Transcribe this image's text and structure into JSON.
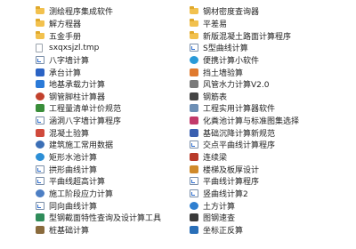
{
  "colors": {
    "folder": "#f2c14e",
    "background": "#ffffff",
    "text": "#222222"
  },
  "left_items": [
    {
      "label": "测绘程序集成软件",
      "icon": "folder-icon",
      "kind": "folder",
      "color": "#f2c14e"
    },
    {
      "label": "解方程器",
      "icon": "folder-icon",
      "kind": "folder",
      "color": "#f2c14e"
    },
    {
      "label": "五金手册",
      "icon": "folder-icon",
      "kind": "folder",
      "color": "#f2c14e"
    },
    {
      "label": "sxqxsjzl.tmp",
      "icon": "tmp-file-icon",
      "kind": "file",
      "color": "#ffffff"
    },
    {
      "label": "八字墙计算",
      "icon": "shortcut-icon",
      "kind": "shortcut",
      "color": "#ffffff"
    },
    {
      "label": "承台计算",
      "icon": "cap-calculation-app-icon",
      "kind": "app",
      "color": "#2b63c4"
    },
    {
      "label": "地基承载力计算",
      "icon": "foundation-bearing-app-icon",
      "kind": "app",
      "color": "#2a7ad8"
    },
    {
      "label": "钢管脚柱计算器",
      "icon": "steel-pipe-app-icon",
      "kind": "round",
      "color": "#c2412d"
    },
    {
      "label": "工程量清单计价规范",
      "icon": "pricing-code-app-icon",
      "kind": "app",
      "color": "#3a8e3a"
    },
    {
      "label": "涵洞八字墙计算程序",
      "icon": "shortcut-icon",
      "kind": "shortcut",
      "color": "#ffffff"
    },
    {
      "label": "混凝土验算",
      "icon": "concrete-check-app-icon",
      "kind": "app",
      "color": "#d04a3c"
    },
    {
      "label": "建筑施工常用数据",
      "icon": "construction-data-app-icon",
      "kind": "round",
      "color": "#3b6fb6"
    },
    {
      "label": "矩形水池计算",
      "icon": "rectangular-tank-app-icon",
      "kind": "round",
      "color": "#2c8fd6"
    },
    {
      "label": "拱形曲线计算",
      "icon": "shortcut-icon",
      "kind": "shortcut",
      "color": "#ffffff"
    },
    {
      "label": "平曲线超高计算",
      "icon": "shortcut-icon",
      "kind": "shortcut",
      "color": "#ffffff"
    },
    {
      "label": "施工阶段应力计算",
      "icon": "stress-calc-app-icon",
      "kind": "round",
      "color": "#4d7fc4"
    },
    {
      "label": "同向曲线计算",
      "icon": "shortcut-icon",
      "kind": "shortcut",
      "color": "#ffffff"
    },
    {
      "label": "型钢截面特性查询及设计算工具",
      "icon": "section-steel-app-icon",
      "kind": "app",
      "color": "#2f8c5a"
    },
    {
      "label": "桩基础计算",
      "icon": "pile-foundation-app-icon",
      "kind": "app",
      "color": "#8a6b3d"
    }
  ],
  "right_items": [
    {
      "label": "钢材密度查询器",
      "icon": "folder-icon",
      "kind": "folder",
      "color": "#f2c14e"
    },
    {
      "label": "平差易",
      "icon": "folder-icon",
      "kind": "folder",
      "color": "#f2c14e"
    },
    {
      "label": "新版混凝土路面计算程序",
      "icon": "folder-icon",
      "kind": "folder",
      "color": "#f2c14e"
    },
    {
      "label": "S型曲线计算",
      "icon": "shortcut-icon",
      "kind": "shortcut",
      "color": "#ffffff"
    },
    {
      "label": "便携计算小软件",
      "icon": "portable-calc-app-icon",
      "kind": "round",
      "color": "#2a9ad8"
    },
    {
      "label": "挡土墙验算",
      "icon": "retaining-wall-app-icon",
      "kind": "app",
      "color": "#e07a2e"
    },
    {
      "label": "风管水力计算V2.0",
      "icon": "duct-hydraulic-app-icon",
      "kind": "app",
      "color": "#7a7a7a"
    },
    {
      "label": "钢筋表",
      "icon": "rebar-table-app-icon",
      "kind": "app",
      "color": "#444444"
    },
    {
      "label": "工程实用计算器软件",
      "icon": "engineering-calculator-app-icon",
      "kind": "app",
      "color": "#6d8fb5"
    },
    {
      "label": "化粪池计算与标准图集选择",
      "icon": "septic-tank-app-icon",
      "kind": "app",
      "color": "#c23a6a"
    },
    {
      "label": "基础沉降计算新规范",
      "icon": "settlement-calc-app-icon",
      "kind": "app",
      "color": "#3a5fb0"
    },
    {
      "label": "交点平曲线计算程序",
      "icon": "shortcut-icon",
      "kind": "shortcut",
      "color": "#ffffff"
    },
    {
      "label": "连续梁",
      "icon": "continuous-beam-app-icon",
      "kind": "app",
      "color": "#b83a2a"
    },
    {
      "label": "楼梯及板厚设计",
      "icon": "stair-slab-app-icon",
      "kind": "app",
      "color": "#d08a2a"
    },
    {
      "label": "平曲线计算程序",
      "icon": "shortcut-icon",
      "kind": "shortcut",
      "color": "#ffffff"
    },
    {
      "label": "竖曲线计算2",
      "icon": "shortcut-icon",
      "kind": "shortcut",
      "color": "#ffffff"
    },
    {
      "label": "土方计算",
      "icon": "earthwork-app-icon",
      "kind": "round",
      "color": "#2f7fd0"
    },
    {
      "label": "图钢速查",
      "icon": "steel-quick-lookup-app-icon",
      "kind": "app",
      "color": "#3a3a3a"
    },
    {
      "label": "坐标正反算",
      "icon": "coordinate-calc-app-icon",
      "kind": "app",
      "color": "#2a6fb8"
    }
  ]
}
